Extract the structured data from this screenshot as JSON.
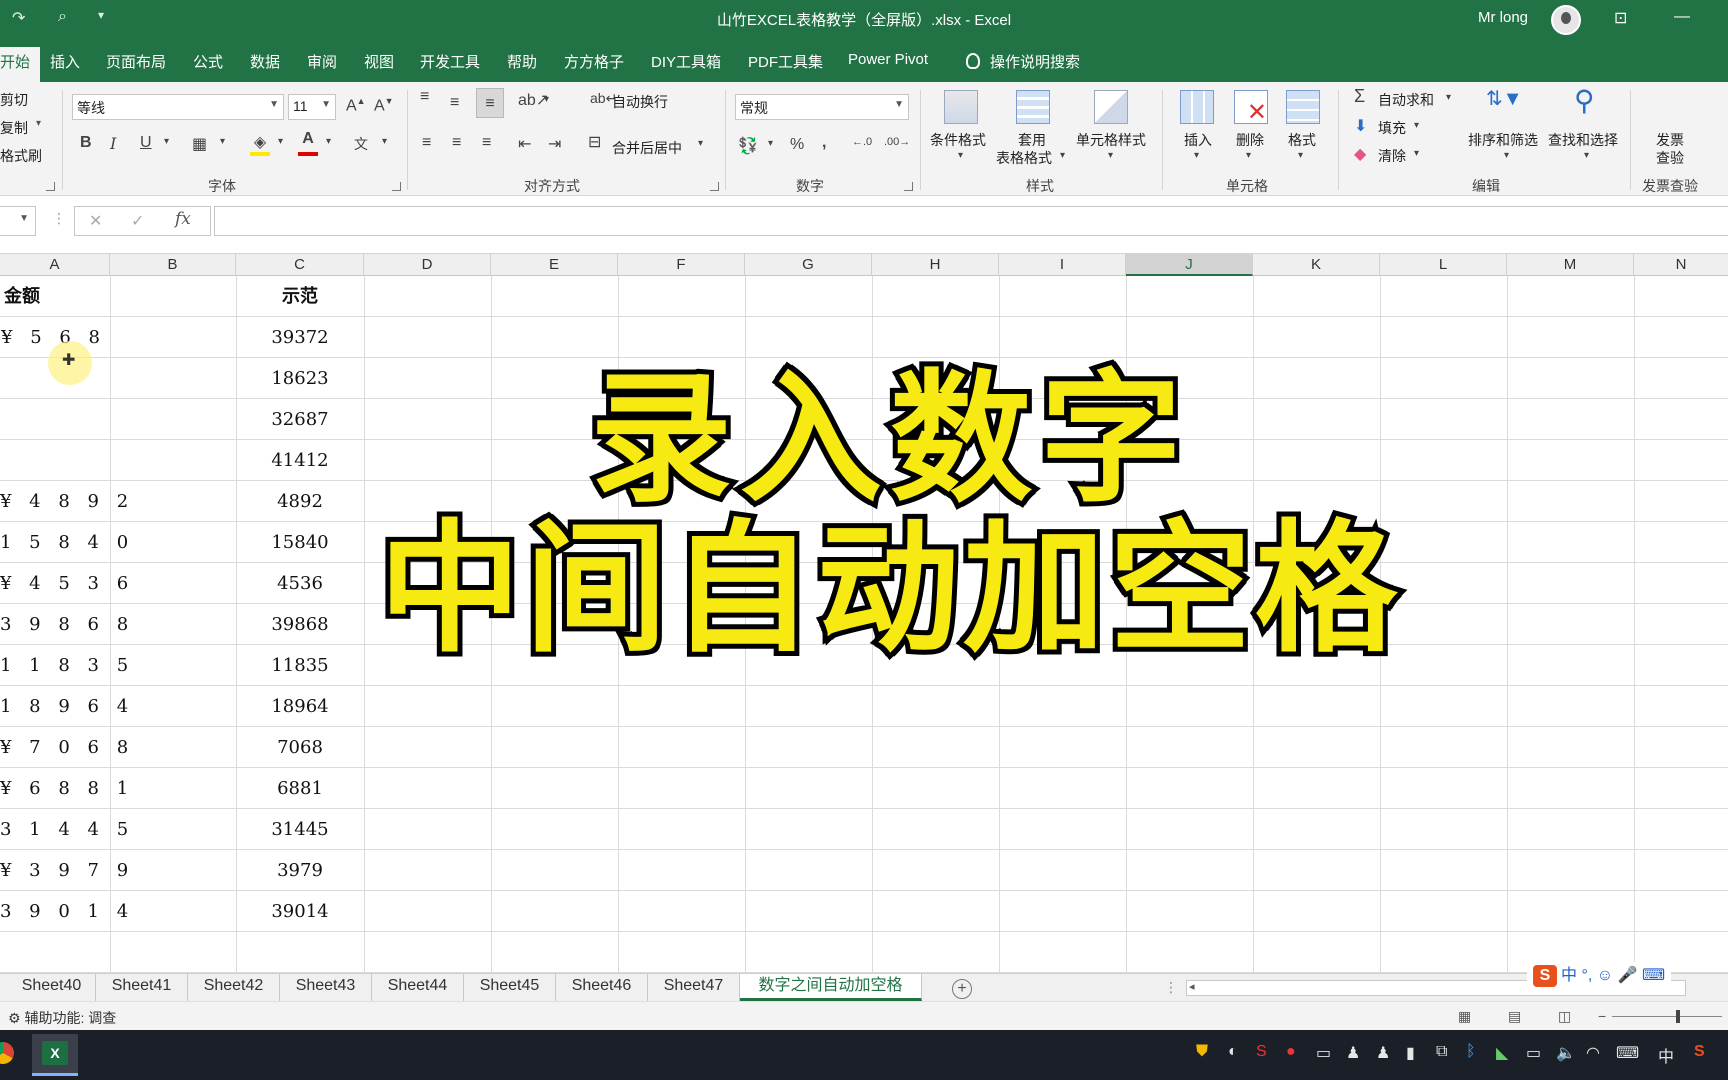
{
  "window": {
    "title": "山竹EXCEL表格教学（全屏版）.xlsx  -  Excel",
    "user": "Mr long"
  },
  "tabs": [
    "开始",
    "插入",
    "页面布局",
    "公式",
    "数据",
    "审阅",
    "视图",
    "开发工具",
    "帮助",
    "方方格子",
    "DIY工具箱",
    "PDF工具集",
    "Power Pivot"
  ],
  "tell_me": "操作说明搜索",
  "clipboard": {
    "cut": "剪切",
    "copy": "复制",
    "painter": "格式刷"
  },
  "font": {
    "name": "等线",
    "size": "11",
    "bold": "B",
    "italic": "I",
    "underline": "U",
    "group": "字体"
  },
  "alignment": {
    "wrap": "自动换行",
    "merge": "合并后居中",
    "group": "对齐方式"
  },
  "number": {
    "format": "常规",
    "group": "数字"
  },
  "styles": {
    "conditional": "条件格式",
    "table_line1": "套用",
    "table_line2": "表格格式",
    "cell": "单元格样式",
    "group": "样式"
  },
  "cells": {
    "insert": "插入",
    "delete": "删除",
    "format": "格式",
    "group": "单元格"
  },
  "editing": {
    "autosum": "自动求和",
    "fill": "填充",
    "clear": "清除",
    "sort": "排序和筛选",
    "find": "查找和选择",
    "group": "编辑"
  },
  "invoice": {
    "line1": "发票",
    "line2": "查验",
    "group": "发票查验"
  },
  "columns": [
    "A",
    "B",
    "C",
    "D",
    "E",
    "F",
    "G",
    "H",
    "I",
    "J",
    "K",
    "L",
    "M",
    "N"
  ],
  "table": {
    "header_a": "金额",
    "header_c": "示范",
    "rows": [
      {
        "a": "¥  5 6 8",
        "c": "39372"
      },
      {
        "a": "",
        "c": "18623"
      },
      {
        "a": "",
        "c": "32687"
      },
      {
        "a": "",
        "c": "41412"
      },
      {
        "a": "¥ 4 8 9 2",
        "c": "4892"
      },
      {
        "a": "1 5 8 4 0",
        "c": "15840"
      },
      {
        "a": "¥ 4 5 3 6",
        "c": "4536"
      },
      {
        "a": "3 9 8 6 8",
        "c": "39868"
      },
      {
        "a": "1 1 8 3 5",
        "c": "11835"
      },
      {
        "a": "1 8 9 6 4",
        "c": "18964"
      },
      {
        "a": "¥ 7 0 6 8",
        "c": "7068"
      },
      {
        "a": "¥ 6 8 8 1",
        "c": "6881"
      },
      {
        "a": "3 1 4 4 5",
        "c": "31445"
      },
      {
        "a": "¥ 3 9 7 9",
        "c": "3979"
      },
      {
        "a": "3 9 0 1 4",
        "c": "39014"
      }
    ]
  },
  "overlay": {
    "line1": "录入数字",
    "line2": "中间自动加空格"
  },
  "sheet_tabs": [
    "Sheet40",
    "Sheet41",
    "Sheet42",
    "Sheet43",
    "Sheet44",
    "Sheet45",
    "Sheet46",
    "Sheet47",
    "数字之间自动加空格"
  ],
  "active_sheet": "数字之间自动加空格",
  "status": {
    "accessibility": "辅助功能: 调查"
  },
  "ime": {
    "label": "中"
  },
  "taskbar": {
    "excel_letter": "X",
    "ime": "中"
  },
  "colors": {
    "excel_green": "#217346",
    "overlay_yellow": "#f7ea12"
  }
}
